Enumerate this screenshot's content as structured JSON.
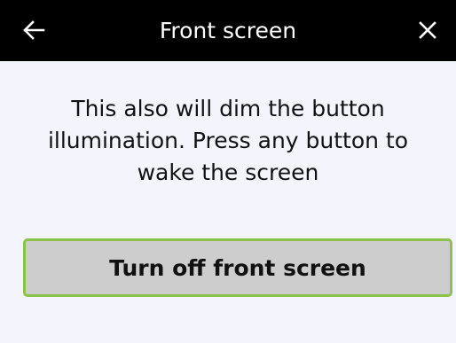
{
  "header": {
    "title": "Front screen",
    "back_icon": "arrow-left-icon",
    "close_icon": "close-icon",
    "background": "#000000",
    "text_color": "#ffffff"
  },
  "main": {
    "message": "This also will dim the button illumination. Press any button to wake the screen",
    "button_label": "Turn off front screen",
    "button_border_color": "#8bc34a",
    "button_background": "#cdcdcd",
    "background": "#f4f5fc"
  }
}
